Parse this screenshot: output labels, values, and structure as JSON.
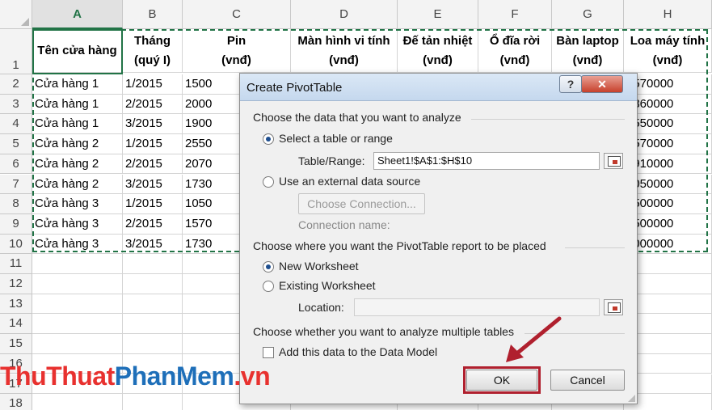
{
  "columns": [
    "A",
    "B",
    "C",
    "D",
    "E",
    "F",
    "G",
    "H"
  ],
  "row_numbers": [
    "1",
    "2",
    "3",
    "4",
    "5",
    "6",
    "7",
    "8",
    "9",
    "10",
    "11",
    "12",
    "13",
    "14",
    "15",
    "16",
    "17",
    "18"
  ],
  "table": {
    "headers": [
      {
        "line1": "Tên cửa hàng",
        "line2": ""
      },
      {
        "line1": "Tháng",
        "line2": "(quý I)"
      },
      {
        "line1": "Pin",
        "line2": "(vnđ)"
      },
      {
        "line1": "Màn hình vi tính",
        "line2": "(vnđ)"
      },
      {
        "line1": "Đế tản nhiệt",
        "line2": "(vnđ)"
      },
      {
        "line1": "Ổ đĩa rời",
        "line2": "(vnđ)"
      },
      {
        "line1": "Bàn laptop",
        "line2": "(vnđ)"
      },
      {
        "line1": "Loa máy tính",
        "line2": "(vnđ)"
      }
    ],
    "rows": [
      [
        "Cửa hàng 1",
        "1/2015",
        "1500",
        "",
        "",
        "",
        "",
        "6570000"
      ],
      [
        "Cửa hàng 1",
        "2/2015",
        "2000",
        "",
        "",
        "",
        "",
        "6860000"
      ],
      [
        "Cửa hàng 1",
        "3/2015",
        "1900",
        "",
        "",
        "",
        "",
        "7550000"
      ],
      [
        "Cửa hàng 2",
        "1/2015",
        "2550",
        "",
        "",
        "",
        "",
        "5570000"
      ],
      [
        "Cửa hàng 2",
        "2/2015",
        "2070",
        "",
        "",
        "",
        "",
        "6910000"
      ],
      [
        "Cửa hàng 2",
        "3/2015",
        "1730",
        "",
        "",
        "",
        "",
        "8050000"
      ],
      [
        "Cửa hàng 3",
        "1/2015",
        "1050",
        "",
        "",
        "",
        "",
        "5500000"
      ],
      [
        "Cửa hàng 3",
        "2/2015",
        "1570",
        "",
        "",
        "",
        "",
        "6500000"
      ],
      [
        "Cửa hàng 3",
        "3/2015",
        "1730",
        "",
        "",
        "",
        "",
        "7000000"
      ]
    ]
  },
  "dialog": {
    "title": "Create PivotTable",
    "help_icon": "?",
    "close_icon": "✕",
    "section1": "Choose the data that you want to analyze",
    "opt_select_table": "Select a table or range",
    "table_range_label": "Table/Range:",
    "table_range_value": "Sheet1!$A$1:$H$10",
    "opt_external": "Use an external data source",
    "choose_connection": "Choose Connection...",
    "connection_name": "Connection name:",
    "section2": "Choose where you want the PivotTable report to be placed",
    "opt_new_ws": "New Worksheet",
    "opt_existing_ws": "Existing Worksheet",
    "location_label": "Location:",
    "location_value": "",
    "section3": "Choose whether you want to analyze multiple tables",
    "add_data_model": "Add this data to the Data Model",
    "ok": "OK",
    "cancel": "Cancel"
  },
  "state": {
    "source": "select-table",
    "placement": "new-worksheet",
    "add_to_data_model": false
  },
  "watermark": {
    "part1": "ThuThuat",
    "part2": "PhanMem",
    "part3": ".vn"
  },
  "colors": {
    "excel_green": "#217346",
    "highlight_red": "#b0202e",
    "watermark_red": "#e8312f",
    "watermark_blue": "#1e6fb9"
  }
}
